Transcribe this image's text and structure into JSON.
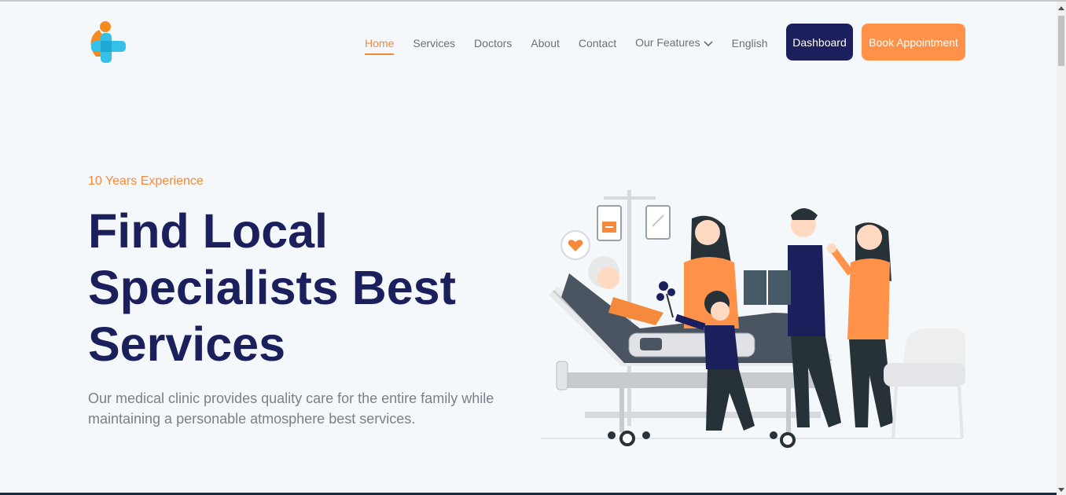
{
  "nav": {
    "items": [
      {
        "label": "Home",
        "active": true
      },
      {
        "label": "Services",
        "active": false
      },
      {
        "label": "Doctors",
        "active": false
      },
      {
        "label": "About",
        "active": false
      },
      {
        "label": "Contact",
        "active": false
      },
      {
        "label": "Our Features",
        "active": false,
        "dropdown": true
      },
      {
        "label": "English",
        "active": false
      }
    ],
    "dashboard_label": "Dashboard",
    "book_label": "Book Appointment"
  },
  "hero": {
    "eyebrow": "10 Years Experience",
    "title_lines": [
      "Find Local",
      "Specialists Best",
      "Services"
    ],
    "description_lines": [
      "Our medical clinic provides quality care for the entire family while",
      "maintaining a personable atmosphere best services."
    ]
  },
  "colors": {
    "primary": "#1b1f5c",
    "accent": "#ff9148",
    "background": "#f5f8fa"
  },
  "icons": {
    "logo": "medical-cross-person-logo",
    "dropdown": "chevron-down-icon"
  }
}
